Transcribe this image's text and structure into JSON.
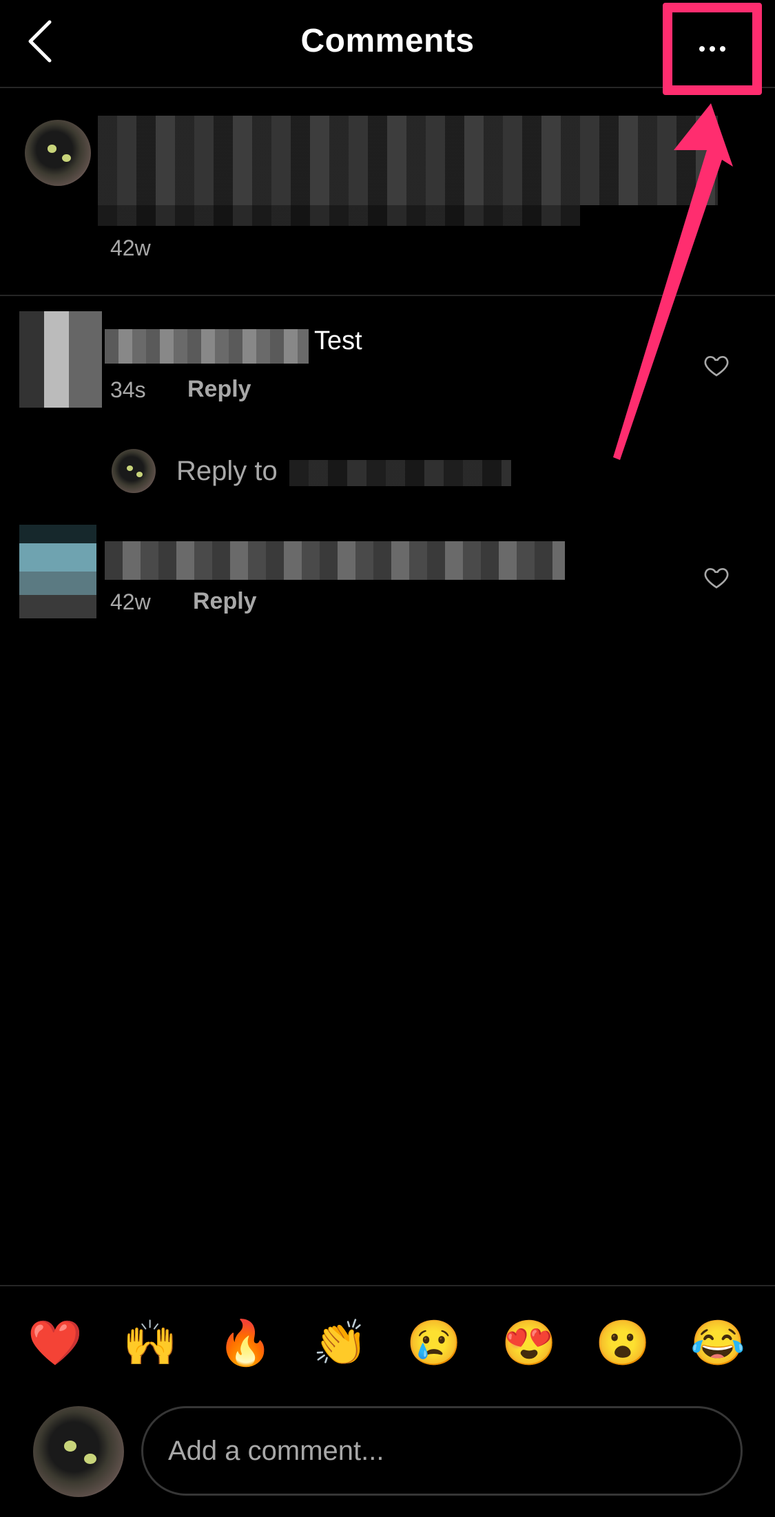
{
  "header": {
    "title": "Comments",
    "back_icon": "chevron-left-icon",
    "more_icon": "more-horizontal-icon",
    "highlight_color": "#ff2d6f"
  },
  "caption": {
    "author": "[blurred]",
    "text": "[blurred caption text]",
    "time": "42w"
  },
  "comments": [
    {
      "author": "[blurred]",
      "text": "Test",
      "time": "34s",
      "reply_label": "Reply",
      "like_icon": "heart-outline-icon",
      "reply_prompt": {
        "label": "Reply to",
        "target": "[blurred]"
      }
    },
    {
      "author": "[blurred]",
      "text": "[blurred comment text]",
      "time": "42w",
      "reply_label": "Reply",
      "like_icon": "heart-outline-icon"
    }
  ],
  "quick_reactions": [
    {
      "emoji": "❤️",
      "name": "red-heart"
    },
    {
      "emoji": "🙌",
      "name": "raising-hands"
    },
    {
      "emoji": "🔥",
      "name": "fire"
    },
    {
      "emoji": "👏",
      "name": "clapping-hands"
    },
    {
      "emoji": "😢",
      "name": "crying-face"
    },
    {
      "emoji": "😍",
      "name": "heart-eyes"
    },
    {
      "emoji": "😮",
      "name": "surprised-face"
    },
    {
      "emoji": "😂",
      "name": "tears-of-joy"
    }
  ],
  "composer": {
    "placeholder": "Add a comment...",
    "value": ""
  },
  "annotation": {
    "type": "arrow",
    "color": "#ff2d6f",
    "points_to": "more-options-button"
  }
}
